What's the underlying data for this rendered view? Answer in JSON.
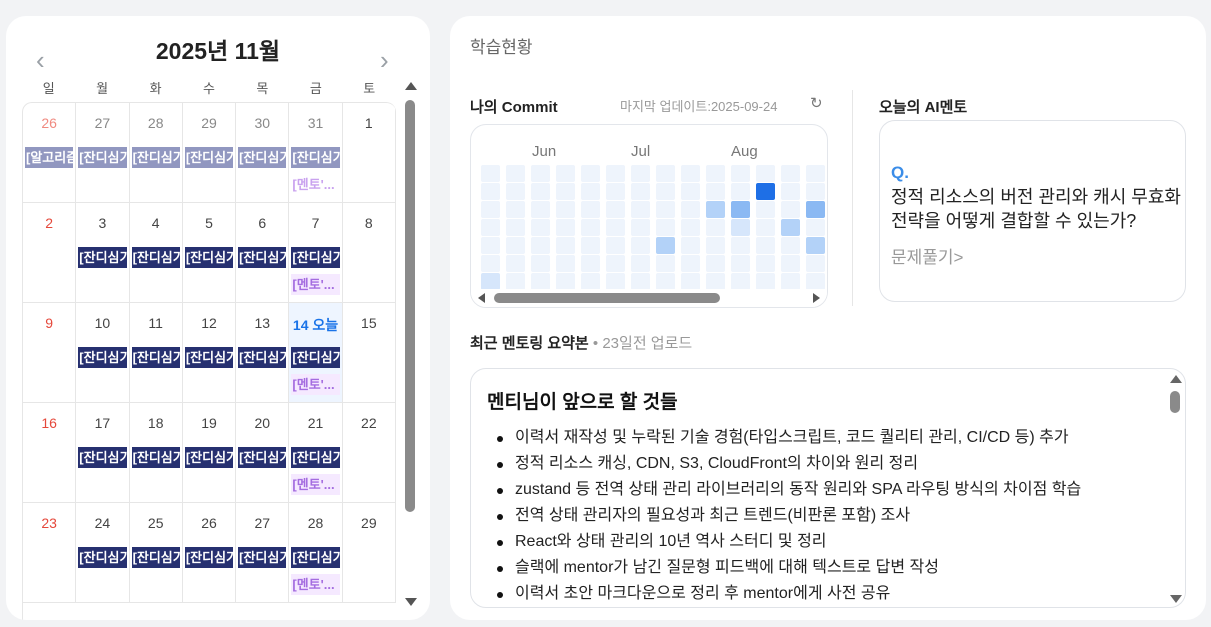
{
  "calendar": {
    "title": "2025년 11월",
    "prev_icon": "chevron-left-icon",
    "next_icon": "chevron-right-icon",
    "weekdays": [
      "일",
      "월",
      "화",
      "수",
      "목",
      "금",
      "토"
    ],
    "weeks": [
      [
        {
          "day": "26",
          "dim": true,
          "events": [
            {
              "type": "commit",
              "label": "[알고리즘]",
              "past": true
            }
          ]
        },
        {
          "day": "27",
          "dim": true,
          "events": [
            {
              "type": "commit",
              "label": "[잔디심기]",
              "past": true
            }
          ]
        },
        {
          "day": "28",
          "dim": true,
          "events": [
            {
              "type": "commit",
              "label": "[잔디심기]",
              "past": true
            }
          ]
        },
        {
          "day": "29",
          "dim": true,
          "events": [
            {
              "type": "commit",
              "label": "[잔디심기]",
              "past": true
            }
          ]
        },
        {
          "day": "30",
          "dim": true,
          "events": [
            {
              "type": "commit",
              "label": "[잔디심기]",
              "past": true
            }
          ]
        },
        {
          "day": "31",
          "dim": true,
          "events": [
            {
              "type": "commit",
              "label": "[잔디심기]",
              "past": true
            },
            {
              "type": "mentor",
              "label": "[멘토'...",
              "past": true
            }
          ]
        },
        {
          "day": "1",
          "events": []
        }
      ],
      [
        {
          "day": "2",
          "events": []
        },
        {
          "day": "3",
          "events": [
            {
              "type": "commit",
              "label": "[잔디심기]"
            }
          ]
        },
        {
          "day": "4",
          "events": [
            {
              "type": "commit",
              "label": "[잔디심기]"
            }
          ]
        },
        {
          "day": "5",
          "events": [
            {
              "type": "commit",
              "label": "[잔디심기]"
            }
          ]
        },
        {
          "day": "6",
          "events": [
            {
              "type": "commit",
              "label": "[잔디심기]"
            }
          ]
        },
        {
          "day": "7",
          "events": [
            {
              "type": "commit",
              "label": "[잔디심기]"
            },
            {
              "type": "mentor",
              "label": "[멘토'..."
            }
          ]
        },
        {
          "day": "8",
          "events": []
        }
      ],
      [
        {
          "day": "9",
          "events": []
        },
        {
          "day": "10",
          "events": [
            {
              "type": "commit",
              "label": "[잔디심기]"
            }
          ]
        },
        {
          "day": "11",
          "events": [
            {
              "type": "commit",
              "label": "[잔디심기]"
            }
          ]
        },
        {
          "day": "12",
          "events": [
            {
              "type": "commit",
              "label": "[잔디심기]"
            }
          ]
        },
        {
          "day": "13",
          "events": [
            {
              "type": "commit",
              "label": "[잔디심기]"
            }
          ]
        },
        {
          "day": "14 오늘",
          "today": true,
          "events": [
            {
              "type": "commit",
              "label": "[잔디심기]"
            },
            {
              "type": "mentor",
              "label": "[멘토'..."
            }
          ]
        },
        {
          "day": "15",
          "events": []
        }
      ],
      [
        {
          "day": "16",
          "events": []
        },
        {
          "day": "17",
          "events": [
            {
              "type": "commit",
              "label": "[잔디심기]"
            }
          ]
        },
        {
          "day": "18",
          "events": [
            {
              "type": "commit",
              "label": "[잔디심기]"
            }
          ]
        },
        {
          "day": "19",
          "events": [
            {
              "type": "commit",
              "label": "[잔디심기]"
            }
          ]
        },
        {
          "day": "20",
          "events": [
            {
              "type": "commit",
              "label": "[잔디심기]"
            }
          ]
        },
        {
          "day": "21",
          "events": [
            {
              "type": "commit",
              "label": "[잔디심기]"
            },
            {
              "type": "mentor",
              "label": "[멘토'..."
            }
          ]
        },
        {
          "day": "22",
          "events": []
        }
      ],
      [
        {
          "day": "23",
          "events": []
        },
        {
          "day": "24",
          "events": [
            {
              "type": "commit",
              "label": "[잔디심기]"
            }
          ]
        },
        {
          "day": "25",
          "events": [
            {
              "type": "commit",
              "label": "[잔디심기]"
            }
          ]
        },
        {
          "day": "26",
          "events": [
            {
              "type": "commit",
              "label": "[잔디심기]"
            }
          ]
        },
        {
          "day": "27",
          "events": [
            {
              "type": "commit",
              "label": "[잔디심기]"
            }
          ]
        },
        {
          "day": "28",
          "events": [
            {
              "type": "commit",
              "label": "[잔디심기]"
            },
            {
              "type": "mentor",
              "label": "[멘토'..."
            }
          ]
        },
        {
          "day": "29",
          "events": []
        }
      ]
    ]
  },
  "panel": {
    "title": "학습현황",
    "commit": {
      "title": "나의 Commit",
      "updated": "마지막 업데이트:2025-09-24",
      "refresh_icon": "refresh-icon",
      "months": [
        "Jun",
        "Jul",
        "Aug"
      ],
      "levels": [
        [
          0,
          0,
          0,
          0,
          0,
          0,
          1
        ],
        [
          0,
          0,
          0,
          0,
          0,
          0,
          0
        ],
        [
          0,
          0,
          0,
          0,
          0,
          0,
          0
        ],
        [
          0,
          0,
          0,
          0,
          0,
          0,
          0
        ],
        [
          0,
          0,
          0,
          0,
          0,
          0,
          0
        ],
        [
          0,
          0,
          0,
          0,
          0,
          0,
          0
        ],
        [
          0,
          0,
          0,
          0,
          0,
          0,
          0
        ],
        [
          0,
          0,
          0,
          0,
          2,
          0,
          0
        ],
        [
          0,
          0,
          0,
          0,
          0,
          0,
          0
        ],
        [
          0,
          0,
          2,
          0,
          0,
          0,
          0
        ],
        [
          0,
          0,
          3,
          1,
          0,
          0,
          0
        ],
        [
          0,
          4,
          0,
          0,
          0,
          0,
          0
        ],
        [
          0,
          0,
          0,
          2,
          0,
          0,
          0
        ],
        [
          0,
          0,
          3,
          0,
          2,
          0,
          0
        ],
        [
          1,
          0,
          0,
          0,
          0,
          1,
          0
        ],
        [
          0,
          0,
          0,
          0,
          0,
          0,
          0
        ]
      ]
    },
    "ai_mentor": {
      "title": "오늘의 AI멘토",
      "q_label": "Q.",
      "question": "정적 리소스의 버전 관리와 캐시 무효화 전략을 어떻게 결합할 수 있는가?",
      "link": "문제풀기>"
    },
    "summary": {
      "title": "최근 멘토링 요약본",
      "uploaded": "• 23일전 업로드",
      "box_title": "멘티님이 앞으로 할 것들",
      "items": [
        "이력서 재작성 및 누락된 기술 경험(타입스크립트, 코드 퀄리티 관리, CI/CD 등) 추가",
        "정적 리소스 캐싱, CDN, S3, CloudFront의 차이와 원리 정리",
        "zustand 등 전역 상태 관리 라이브러리의 동작 원리와 SPA 라우팅 방식의 차이점 학습",
        "전역 상태 관리자의 필요성과 최근 트렌드(비판론 포함) 조사",
        "React와 상태 관리의 10년 역사 스터디 및 정리",
        "슬랙에 mentor가 남긴 질문형 피드백에 대해 텍스트로 답변 작성",
        "이력서 초안 마크다운으로 정리 후 mentor에게 사전 공유"
      ]
    }
  }
}
